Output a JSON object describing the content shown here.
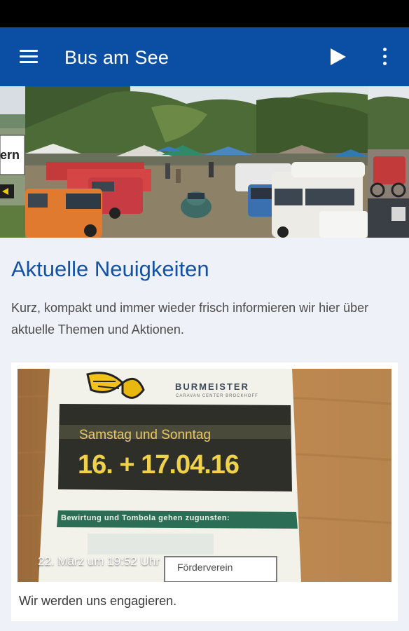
{
  "app_bar": {
    "title": "Bus am See",
    "menu_icon": "hamburger-menu-icon",
    "play_icon": "play-icon",
    "more_icon": "more-vertical-icon",
    "color": "#0a4fa3"
  },
  "carousel": {
    "left_slide_sign_text": "ern",
    "slides": [
      "event-camp-photo"
    ]
  },
  "section": {
    "title": "Aktuelle Neuigkeiten",
    "description": "Kurz, kompakt und immer wieder frisch informieren wir hier über aktuelle Themen und Aktionen."
  },
  "news": {
    "date": "22. März um 19:52 Uhr",
    "caption": "Wir werden uns engagieren.",
    "flyer": {
      "brand": "BURMEISTER",
      "brand_sub": "CARAVAN CENTER BROCKHOFF",
      "days": "Samstag und Sonntag",
      "dates": "16. + 17.04.16",
      "band_text": "Bewirtung und Tombola gehen zugunsten:",
      "box_text": "Förderverein"
    }
  }
}
